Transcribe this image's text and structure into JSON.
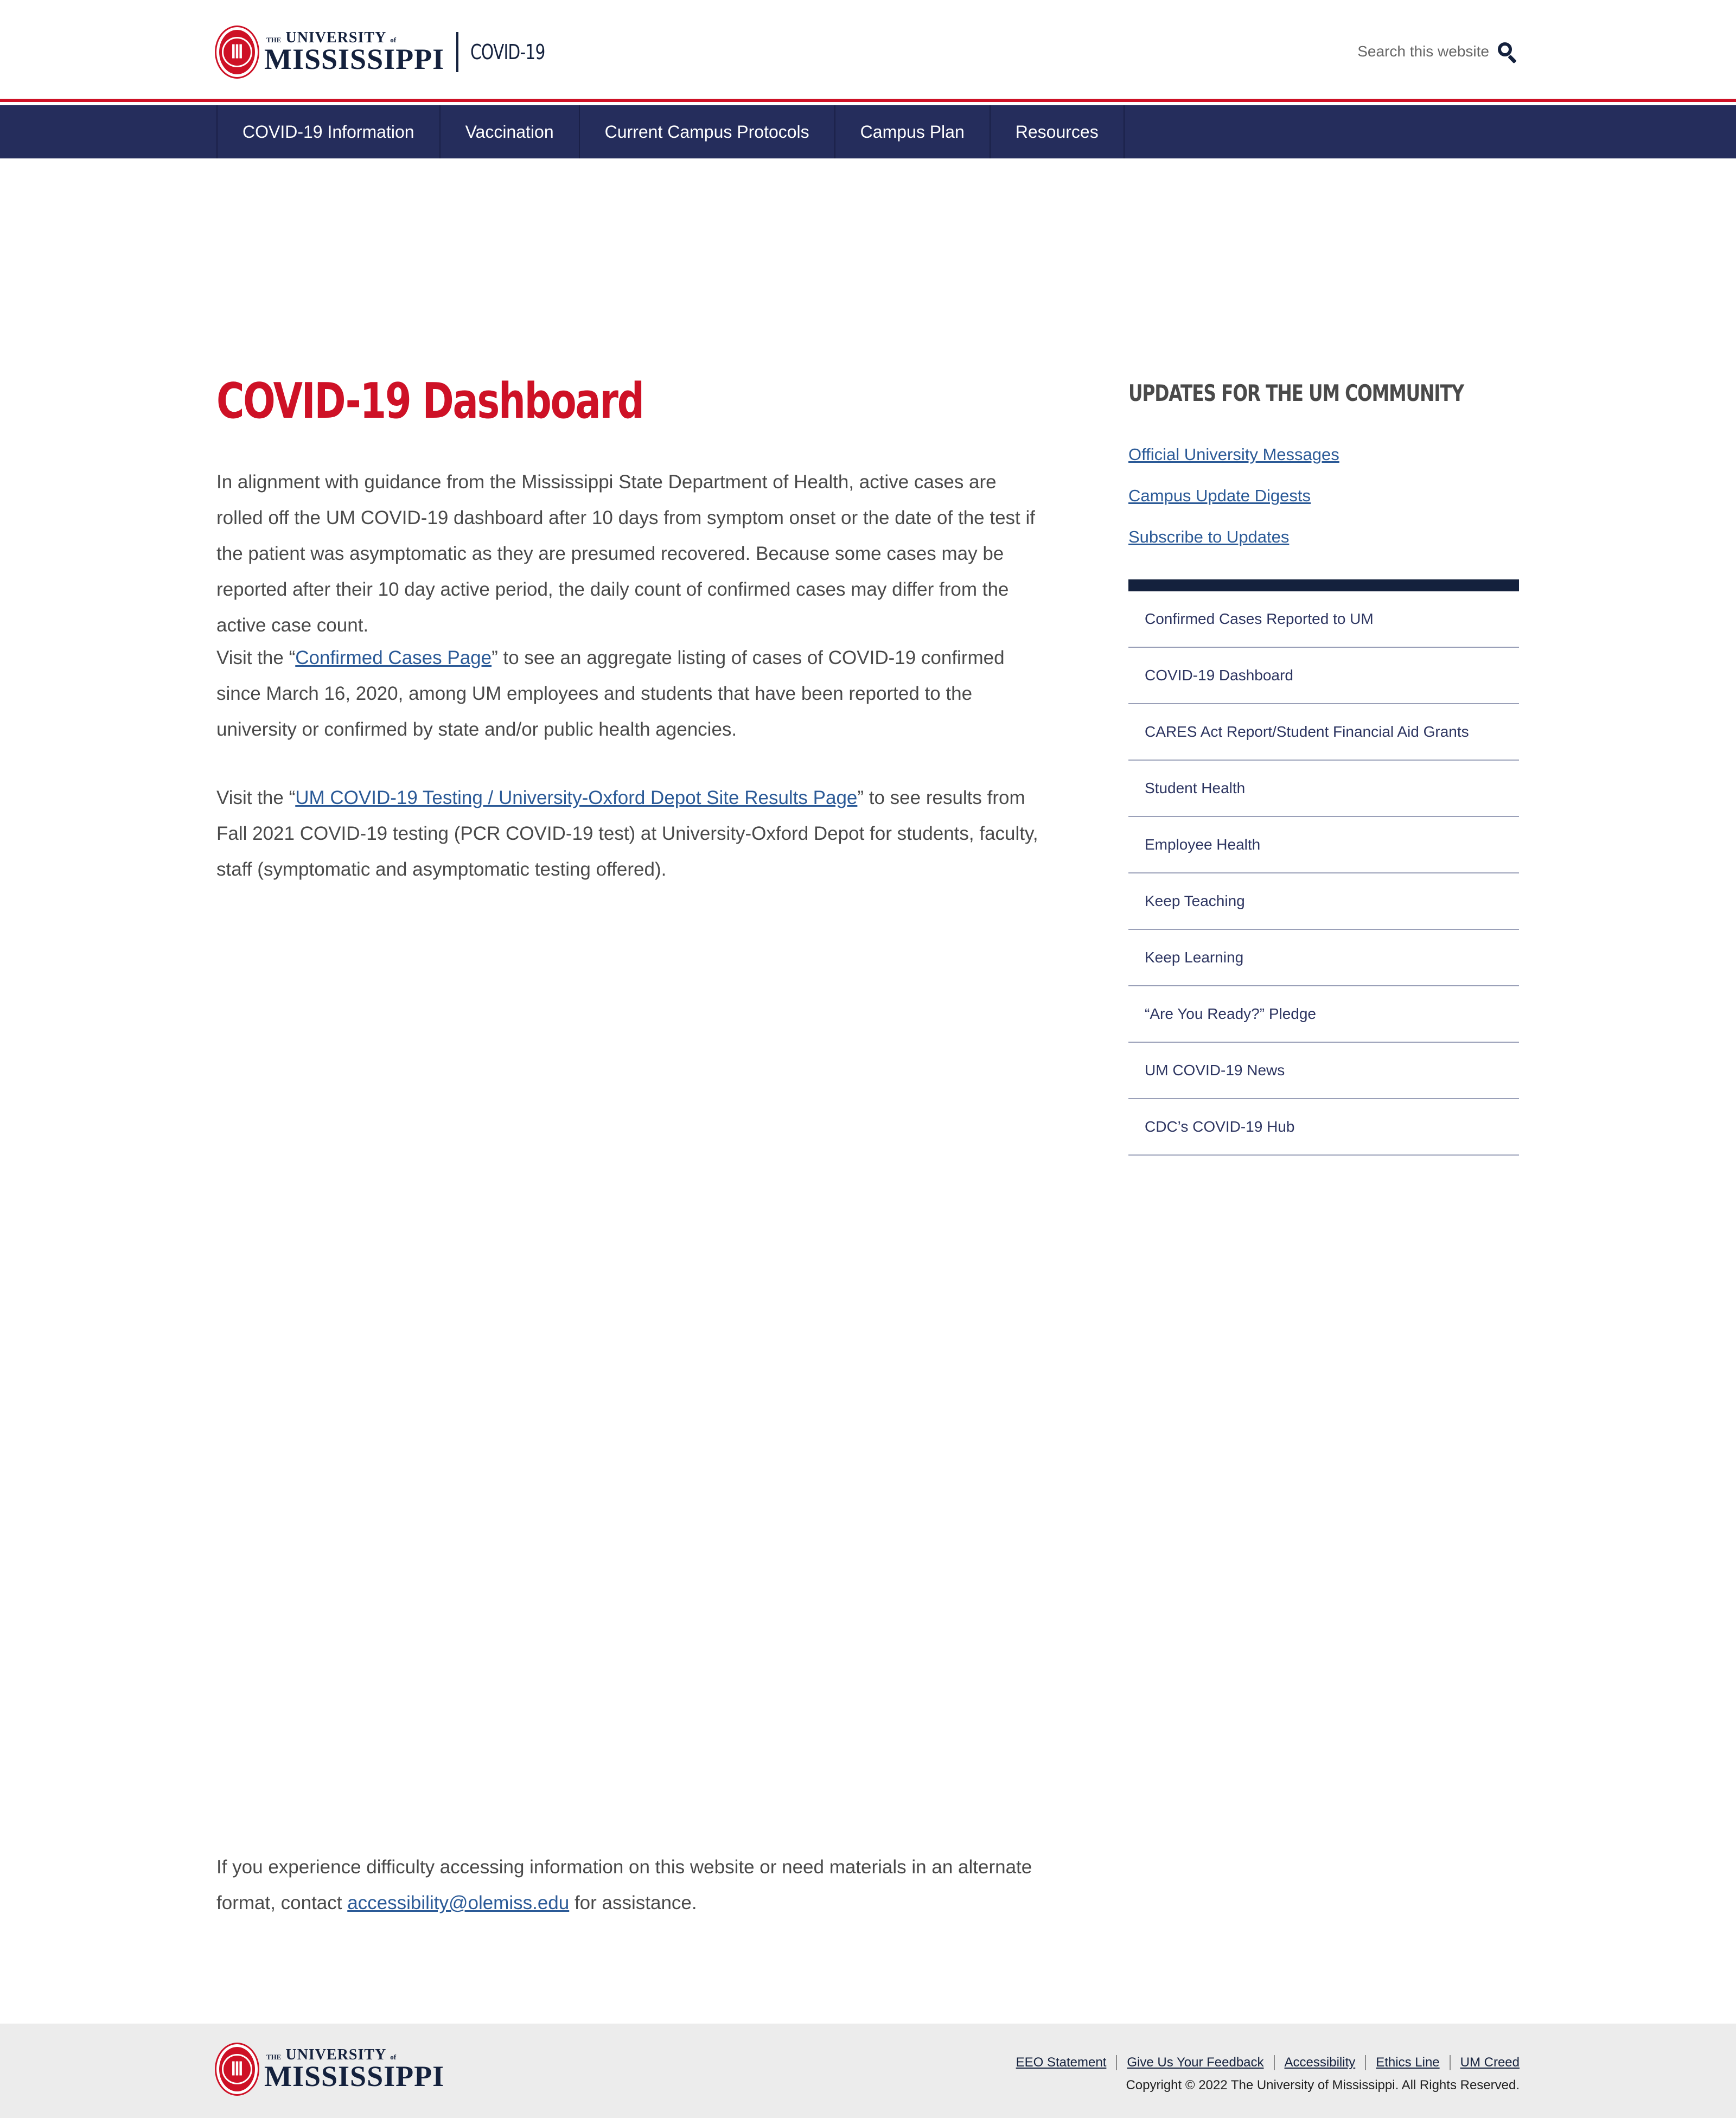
{
  "header": {
    "logo": {
      "the": "THE",
      "university": "UNIVERSITY",
      "of": "of",
      "name": "MISSISSIPPI",
      "seal_glyph": "Ⅲ"
    },
    "site_name": "COVID-19",
    "search": {
      "placeholder": "Search this website",
      "icon": "search-icon"
    }
  },
  "nav": {
    "items": [
      {
        "label": "COVID-19 Information"
      },
      {
        "label": "Vaccination"
      },
      {
        "label": "Current Campus Protocols"
      },
      {
        "label": "Campus Plan"
      },
      {
        "label": "Resources"
      }
    ]
  },
  "main": {
    "title": "COVID-19 Dashboard",
    "paragraph1": "In alignment with guidance from the Mississippi State Department of Health, active cases are rolled off the UM COVID-19 dashboard after 10 days from symptom onset or the date of the test if the patient was asymptomatic as they are presumed recovered. Because some cases may be reported after their 10 day active period, the daily count of confirmed cases may differ from the active case count.",
    "paragraph2": {
      "before": "Visit the “",
      "link": "Confirmed Cases Page",
      "after": "” to see an aggregate listing of cases of COVID-19 confirmed since March 16, 2020, among UM employees and students that have been reported to the university or confirmed by state and/or public health agencies."
    },
    "paragraph3": {
      "before": "Visit the “",
      "link": "UM COVID-19 Testing / University-Oxford Depot Site Results Page",
      "after": "” to see results from Fall 2021 COVID-19 testing (PCR COVID-19 test) at University-Oxford Depot for students, faculty, staff (symptomatic and asymptomatic testing offered)."
    },
    "accessibility": {
      "before": "If you experience difficulty accessing information on this website or need materials in an alternate format, contact ",
      "link": "accessibility@olemiss.edu",
      "after": " for assistance."
    }
  },
  "sidebar": {
    "heading": "Updates for the UM Community",
    "updates": [
      {
        "label": "Official University Messages"
      },
      {
        "label": "Campus Update Digests"
      },
      {
        "label": "Subscribe to Updates"
      }
    ],
    "links": [
      {
        "label": "Confirmed Cases Reported to UM"
      },
      {
        "label": "COVID-19 Dashboard"
      },
      {
        "label": "CARES Act Report/Student Financial Aid Grants"
      },
      {
        "label": "Student Health"
      },
      {
        "label": "Employee Health"
      },
      {
        "label": "Keep Teaching"
      },
      {
        "label": "Keep Learning"
      },
      {
        "label": "“Are You Ready?” Pledge"
      },
      {
        "label": "UM COVID-19 News"
      },
      {
        "label": "CDC’s COVID-19 Hub"
      }
    ]
  },
  "footer": {
    "links": [
      {
        "label": "EEO Statement"
      },
      {
        "label": "Give Us Your Feedback"
      },
      {
        "label": "Accessibility"
      },
      {
        "label": "Ethics Line"
      },
      {
        "label": "UM Creed"
      }
    ],
    "copyright": "Copyright © 2022 The University of Mississippi. All Rights Reserved."
  },
  "colors": {
    "brand_red": "#ce1126",
    "brand_navy": "#14213d",
    "nav_background": "#252d5c",
    "link_blue": "#2b5a97"
  }
}
